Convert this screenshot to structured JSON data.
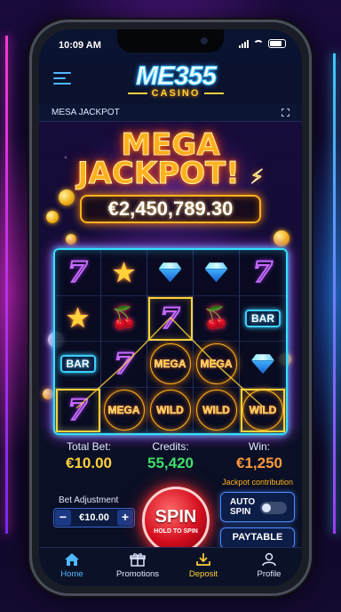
{
  "status_bar": {
    "time": "10:09 AM"
  },
  "header": {
    "logo_main": "ME355",
    "logo_sub": "CASINO"
  },
  "subbar": {
    "title": "MESA JACKPOT"
  },
  "jackpot": {
    "headline_line1": "MEGA",
    "headline_line2": "JACKPOT!",
    "amount": "€2,450,789.30"
  },
  "reels": {
    "rows": [
      [
        "seven",
        "star",
        "gem",
        "gem",
        "seven"
      ],
      [
        "star",
        "cherry",
        "seven",
        "cherry",
        "bar"
      ],
      [
        "bar",
        "seven",
        "mega",
        "mega",
        "gem"
      ],
      [
        "seven",
        "mega",
        "wild",
        "wild",
        "wild"
      ]
    ],
    "labels": {
      "bar": "BAR",
      "mega": "MEGA",
      "wild": "WILD",
      "seven": "7",
      "star": "★",
      "cherry": "🍒"
    }
  },
  "stats": {
    "total_bet_label": "Total Bet:",
    "total_bet_value": "€10.00",
    "credits_label": "Credits:",
    "credits_value": "55,420",
    "win_label": "Win:",
    "win_value": "€1,250",
    "win_note": "Jackpot contribution"
  },
  "controls": {
    "bet_adjustment_label": "Bet Adjustment",
    "bet_value": "€10.00",
    "minus": "−",
    "plus": "+",
    "spin_label": "SPIN",
    "spin_sub": "HOLD TO SPIN",
    "auto_spin_label": "AUTO SPIN",
    "auto_spin_on": false,
    "paytable_label": "PAYTABLE"
  },
  "tabs": [
    {
      "label": "Home",
      "icon": "home-icon",
      "active": true
    },
    {
      "label": "Promotions",
      "icon": "gift-icon"
    },
    {
      "label": "Deposit",
      "icon": "download-icon"
    },
    {
      "label": "Profile",
      "icon": "user-icon"
    }
  ],
  "colors": {
    "accent": "#4fb8ff",
    "gold": "#ffb21e",
    "credits": "#3ee06a",
    "win": "#ff9a3a",
    "spin": "#d40e1e"
  }
}
